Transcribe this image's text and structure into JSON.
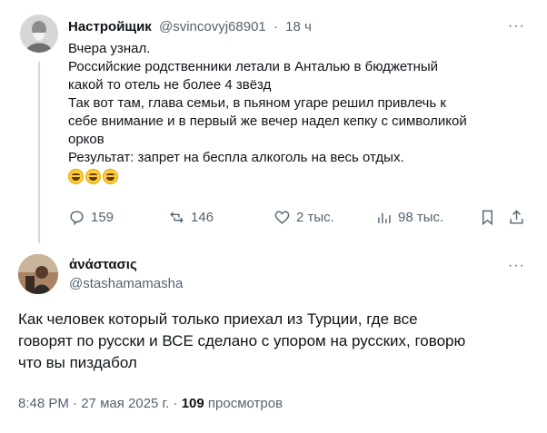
{
  "parent_tweet": {
    "author_name": "Настройщик",
    "handle": "@svincovyj68901",
    "separator": "·",
    "time": "18 ч",
    "more": "···",
    "lines": [
      "Вчера узнал.",
      "Российские родственники летали в Анталью в бюджетный",
      "какой то отель не более 4 звёзд",
      "Так вот там, глава семьи, в пьяном угаре решил привлечь к",
      "себе внимание и в первый же вечер надел кепку с  символикой",
      "орков",
      "Результат: запрет на беспла алкоголь на весь отдых."
    ],
    "emojis": [
      "grinning-face",
      "grinning-face",
      "grinning-face"
    ],
    "actions": {
      "replies": "159",
      "reposts": "146",
      "likes": "2 тыс.",
      "views": "98 тыс."
    }
  },
  "reply_tweet": {
    "author_name": "ἀνάστασις",
    "handle": "@stashamamasha",
    "more": "···",
    "lines": [
      "Как человек который только приехал из Турции, где все",
      "говорят по русски и ВСЕ сделано с упором на русских, говорю",
      "что вы пиздабол"
    ],
    "footer": {
      "time": "8:48 PM",
      "sep": "·",
      "date": "27 мая 2025 г.",
      "views_count": "109",
      "views_label": "просмотров"
    }
  },
  "colors": {
    "text": "#0f1419",
    "secondary": "#536471",
    "thread_line": "#cfd9de",
    "emoji": "#ffcc3d"
  }
}
